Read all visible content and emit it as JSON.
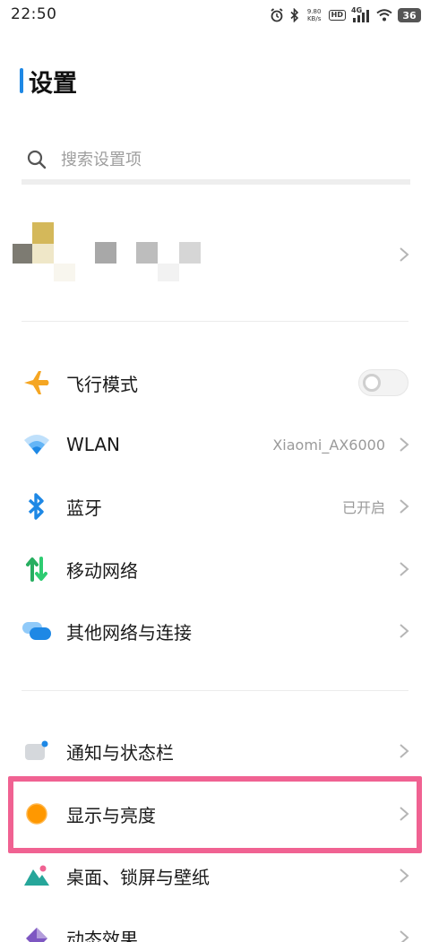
{
  "status_bar": {
    "time": "22:50",
    "net_speed_value": "9.80",
    "net_speed_unit": "KB/s",
    "hd_label": "HD",
    "signal_label": "4G",
    "battery": "36"
  },
  "header": {
    "title": "设置"
  },
  "search": {
    "placeholder": "搜索设置项"
  },
  "settings_group_network": [
    {
      "label": "飞行模式",
      "icon": "airplane-icon",
      "toggle_on": false
    },
    {
      "label": "WLAN",
      "value": "Xiaomi_AX6000",
      "icon": "wifi-icon"
    },
    {
      "label": "蓝牙",
      "value": "已开启",
      "icon": "bluetooth-icon"
    },
    {
      "label": "移动网络",
      "icon": "mobile-data-icon"
    },
    {
      "label": "其他网络与连接",
      "icon": "network-connection-icon"
    }
  ],
  "settings_group_display": [
    {
      "label": "通知与状态栏",
      "icon": "notification-icon"
    },
    {
      "label": "显示与亮度",
      "icon": "brightness-icon"
    },
    {
      "label": "桌面、锁屏与壁纸",
      "icon": "wallpaper-icon"
    },
    {
      "label": "动态效果",
      "icon": "animation-icon"
    }
  ],
  "colors": {
    "accent": "#1e88e5",
    "highlight": "#f06292",
    "airplane": "#f5a623",
    "wifi": "#2196f3",
    "mobile_data": "#2ecc71",
    "brightness": "#ff9800"
  }
}
